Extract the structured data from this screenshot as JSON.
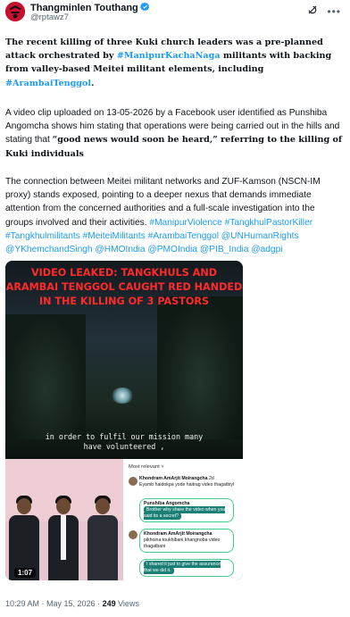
{
  "author": {
    "name": "Thangminlen Touthang",
    "handle": "@rptawz7",
    "avatar_color": "#c8102e",
    "verified_color": "#1d9bf0",
    "icons": [
      "grok-icon",
      "more-icon"
    ]
  },
  "post": {
    "p1_a": "The recent killing of three Kuki church leaders was a pre-planned attack orchestrated by ",
    "p1_tag1": "#ManipurKachaNaga",
    "p1_b": " militants with backing from valley-based Meitei militant elements, including ",
    "p1_tag2": "#ArambaiTenggol",
    "p1_c": ".",
    "p2_a": "A video clip uploaded on 13-05-2026 by a Facebook user identified as Punshiba Angomcha shows him stating that operations were being carried out in the hills and stating that ",
    "p2_b": "“good news would soon be heard,” referring to the killing of Kuki individuals",
    "p3_a": "The connection between Meitei militant networks and ZUF-Kamson (NSCN-IM proxy) stands exposed, pointing to a deeper nexus that demands immediate attention from the concerned authorities and a full-scale investigation into the groups involved and their activities.",
    "hashtags": "#ManipurViolence #TangkhulPastorKiller #Tangkhulmilitants #MeiteiMilitants #ArambaiTenggol @UNHumanRights @YKhemchandSingh @HMOIndia @PMOIndia @PIB_India @adgpi",
    "link_color": "#1d9bf0"
  },
  "media": {
    "banner": "VIDEO LEAKED: TANGKHULS AND ARAMBAI TENGGOL CAUGHT RED HANDED IN THE KILLING OF 3 PASTORS",
    "banner_color": "#ff2a2a",
    "subtitle_line1": "in order to fulfil our mission many",
    "subtitle_line2": "have volunteered ,",
    "duration": "1:07",
    "comments": {
      "header": "Most relevant ˅",
      "c1_name": "Khondram AmArjit Moirangcha",
      "c1_time": "2d",
      "c1_text": "Eyamb haidokpa yode haitrag video thagatbiyl",
      "c2_name": "Punshiba Angomcha",
      "c2_text": "Brother why share the video when you said its a secret?",
      "c3_name": "Khondram AmArjit Moirangcha",
      "c3_text": "pikhoina toukhibani khangnoba video thagatbani",
      "c4_text": "I shared it just to give the assurance that we did it."
    }
  },
  "meta": {
    "time": "10:29 AM · May 15, 2026 · ",
    "views_count": "249",
    "views_label": " Views"
  }
}
